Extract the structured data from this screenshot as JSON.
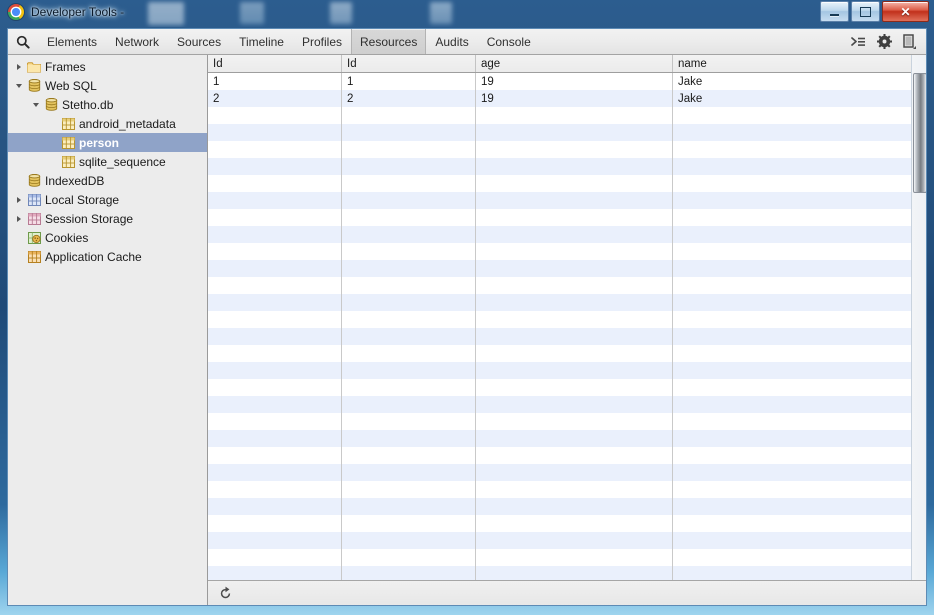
{
  "window": {
    "title": "Developer Tools -",
    "logo_icon": "chrome-logo-icon",
    "buttons": {
      "minimize": "minimize-icon",
      "maximize": "maximize-icon",
      "close_label": "✕"
    }
  },
  "toolbar": {
    "search_icon": "search-icon",
    "tabs": [
      {
        "label": "Elements",
        "selected": false
      },
      {
        "label": "Network",
        "selected": false
      },
      {
        "label": "Sources",
        "selected": false
      },
      {
        "label": "Timeline",
        "selected": false
      },
      {
        "label": "Profiles",
        "selected": false
      },
      {
        "label": "Resources",
        "selected": true
      },
      {
        "label": "Audits",
        "selected": false
      },
      {
        "label": "Console",
        "selected": false
      }
    ],
    "right_icons": [
      {
        "name": "console-drawer-icon"
      },
      {
        "name": "gear-icon"
      },
      {
        "name": "dock-position-icon"
      }
    ]
  },
  "sidebar": {
    "items": [
      {
        "label": "Frames",
        "indent": 0,
        "twisty": "closed",
        "icon": "folder-icon",
        "selected": false
      },
      {
        "label": "Web SQL",
        "indent": 0,
        "twisty": "open",
        "icon": "database-icon",
        "selected": false
      },
      {
        "label": "Stetho.db",
        "indent": 1,
        "twisty": "open",
        "icon": "database-icon",
        "selected": false
      },
      {
        "label": "android_metadata",
        "indent": 2,
        "twisty": "none",
        "icon": "table-icon-yellow",
        "selected": false
      },
      {
        "label": "person",
        "indent": 2,
        "twisty": "none",
        "icon": "table-icon-yellow",
        "selected": true
      },
      {
        "label": "sqlite_sequence",
        "indent": 2,
        "twisty": "none",
        "icon": "table-icon-yellow",
        "selected": false
      },
      {
        "label": "IndexedDB",
        "indent": 0,
        "twisty": "none",
        "icon": "database-icon",
        "selected": false
      },
      {
        "label": "Local Storage",
        "indent": 0,
        "twisty": "closed",
        "icon": "table-icon-blue",
        "selected": false
      },
      {
        "label": "Session Storage",
        "indent": 0,
        "twisty": "closed",
        "icon": "table-icon-pink",
        "selected": false
      },
      {
        "label": "Cookies",
        "indent": 0,
        "twisty": "none",
        "icon": "cookie-icon",
        "selected": false
      },
      {
        "label": "Application Cache",
        "indent": 0,
        "twisty": "none",
        "icon": "table-icon-orange",
        "selected": false
      }
    ]
  },
  "table": {
    "columns": [
      "Id",
      "Id",
      "age",
      "name"
    ],
    "rows": [
      [
        "1",
        "1",
        "19",
        "Jake"
      ],
      [
        "2",
        "2",
        "19",
        "Jake"
      ]
    ],
    "empty_row_count": 29
  },
  "status": {
    "refresh_icon": "refresh-icon"
  },
  "colors": {
    "selection": "#8fa3c8",
    "row_stripe": "#eaf0fc",
    "accent_close": "#c1301b"
  }
}
